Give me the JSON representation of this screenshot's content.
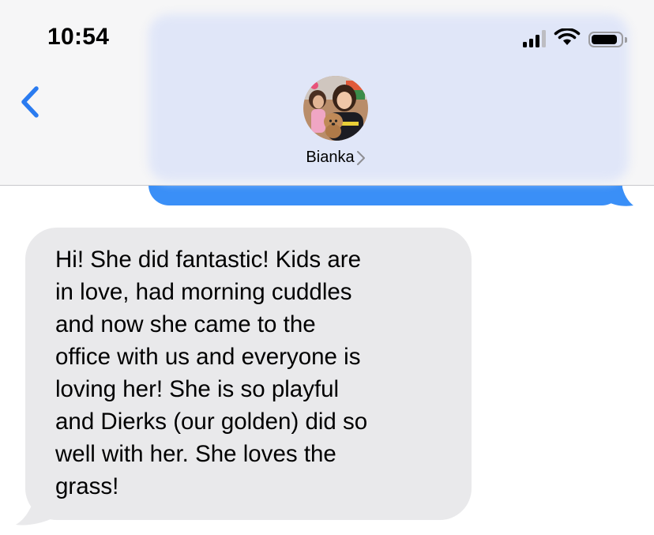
{
  "status_bar": {
    "time": "10:54",
    "signal_bars_filled": 3,
    "signal_bars_total": 4,
    "battery_level": 0.9
  },
  "header": {
    "contact_name": "Bianka",
    "icons": [
      "back-chevron-icon",
      "signal-icon",
      "wifi-icon",
      "battery-icon",
      "contact-avatar",
      "chevron-right-icon"
    ]
  },
  "colors": {
    "sent_bubble": "#3a8ff7",
    "received_bubble": "#e9e9eb",
    "back_chevron": "#2a7bf0",
    "header_background": "#f6f6f7"
  },
  "messages": [
    {
      "direction": "sent",
      "text": ""
    },
    {
      "direction": "received",
      "text": "Hi! She did fantastic! Kids are\nin love, had morning cuddles\nand now she came to the\noffice with us and everyone is\nloving her! She is so playful\nand Dierks (our golden) did so\nwell with her. She loves the\ngrass!"
    }
  ]
}
